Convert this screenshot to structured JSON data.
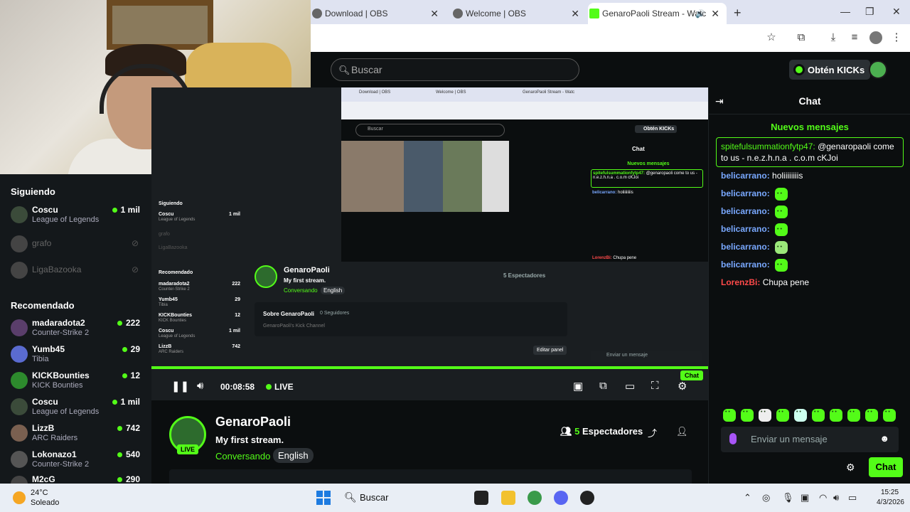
{
  "browser": {
    "tabs": [
      {
        "label": "Download | OBS"
      },
      {
        "label": "Welcome | OBS"
      },
      {
        "label": "GenaroPaoli Stream - Watc"
      }
    ],
    "new_tab": "+"
  },
  "header": {
    "search_placeholder": "Buscar",
    "get_kicks": "Obtén KICKs"
  },
  "sidebar": {
    "following_title": "Siguiendo",
    "following": [
      {
        "name": "Coscu",
        "category": "League of Legends",
        "viewers": "1 mil"
      },
      {
        "name": "grafo",
        "offline": true
      },
      {
        "name": "LigaBazooka",
        "offline": true
      }
    ],
    "recommended_title": "Recomendado",
    "recommended": [
      {
        "name": "madaradota2",
        "category": "Counter-Strike 2",
        "viewers": "222"
      },
      {
        "name": "Yumb45",
        "category": "Tibia",
        "viewers": "29"
      },
      {
        "name": "KICKBounties",
        "category": "KICK Bounties",
        "viewers": "12"
      },
      {
        "name": "Coscu",
        "category": "League of Legends",
        "viewers": "1 mil"
      },
      {
        "name": "LizzB",
        "category": "ARC Raiders",
        "viewers": "742"
      },
      {
        "name": "Lokonazo1",
        "category": "Counter-Strike 2",
        "viewers": "540"
      },
      {
        "name": "M2cG",
        "category": "",
        "viewers": "290"
      }
    ]
  },
  "player": {
    "time": "00:08:58",
    "live": "LIVE",
    "nested": {
      "tabs": [
        "Download | OBS",
        "Welcome | OBS",
        "GenaroPaoli Stream - Watc"
      ],
      "search": "Buscar",
      "get_kicks": "Obtén KICKs",
      "chat_title": "Chat",
      "new_messages": "Nuevos mensajes",
      "about": "Sobre GenaroPaoli",
      "followers": "0 Seguidores",
      "channel_desc": "GenaroPaoli's Kick Channel",
      "edit_panel": "Editar panel",
      "viewers": "5 Espectadores",
      "send_placeholder": "Enviar un mensaje",
      "chat_button": "Chat",
      "side_following": "Siguiendo",
      "side_recommended": "Recomendado"
    }
  },
  "stream": {
    "streamer": "GenaroPaoli",
    "live_badge": "LIVE",
    "title": "My first stream.",
    "category": "Conversando",
    "language": "English",
    "viewers_count": "5",
    "viewers_label": "Espectadores"
  },
  "chat": {
    "title": "Chat",
    "new_messages": "Nuevos mensajes",
    "pinned": {
      "user": "spitefulsummationfytp47:",
      "text": "@genaropaoli come to us - n.e.z.h.n.a . c.o.m cKJoi"
    },
    "messages": [
      {
        "user": "belicarrano:",
        "text": "holiiiiiiiis"
      },
      {
        "user": "belicarrano:",
        "text": ""
      },
      {
        "user": "belicarrano:",
        "text": ""
      },
      {
        "user": "belicarrano:",
        "text": ""
      },
      {
        "user": "belicarrano:",
        "text": ""
      },
      {
        "user": "belicarrano:",
        "text": ""
      },
      {
        "user": "LorenzBi:",
        "text": "Chupa pene"
      }
    ],
    "input_placeholder": "Enviar un mensaje",
    "send": "Chat",
    "colors": {
      "accent": "#53fc18",
      "user_blue": "#79a8ff",
      "user_red": "#ff4a4a"
    }
  },
  "taskbar": {
    "temp": "24°C",
    "weather": "Soleado",
    "search": "Buscar",
    "time": "15:25",
    "date": "4/3/2026"
  }
}
